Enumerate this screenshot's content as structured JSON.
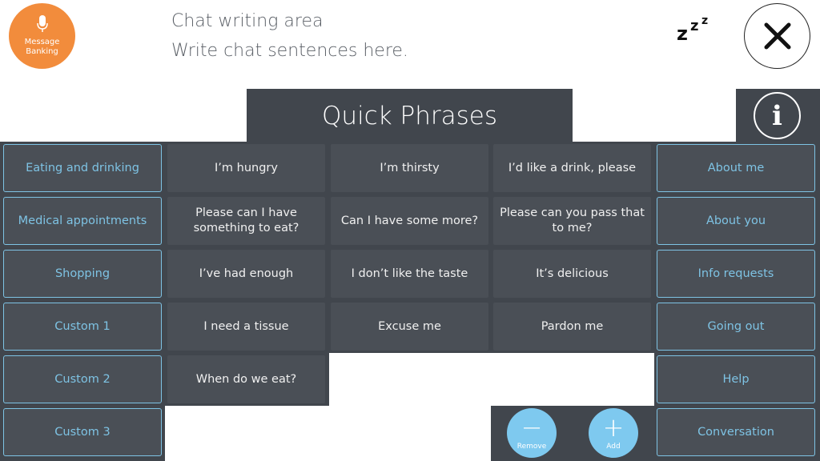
{
  "header": {
    "message_banking_label": "Message Banking",
    "chat_line_1": "Chat writing area",
    "chat_line_2": "Write chat sentences here.",
    "sleep_icon": "zzz-icon",
    "close_icon": "close-icon"
  },
  "panel": {
    "title": "Quick Phrases",
    "info_label": "i"
  },
  "categories_left": [
    "Eating and drinking",
    "Medical appointments",
    "Shopping",
    "Custom 1",
    "Custom 2",
    "Custom 3"
  ],
  "categories_right": [
    "About me",
    "About you",
    "Info requests",
    "Going out",
    "Help",
    "Conversation"
  ],
  "phrases": [
    [
      "I’m hungry",
      "I’m thirsty",
      "I’d like a drink, please"
    ],
    [
      "Please can I have something to eat?",
      "Can I have some more?",
      "Please can you pass that to me?"
    ],
    [
      "I’ve had enough",
      "I don’t like the taste",
      "It’s delicious"
    ],
    [
      "I need a tissue",
      "Excuse me",
      "Pardon me"
    ],
    [
      "When do we eat?"
    ]
  ],
  "actions": {
    "remove_label": "Remove",
    "add_label": "Add"
  },
  "colors": {
    "accent_orange": "#f28c3c",
    "accent_blue": "#7ec3e4",
    "panel_dark": "#41464d",
    "button_dark": "#4a4f56"
  }
}
